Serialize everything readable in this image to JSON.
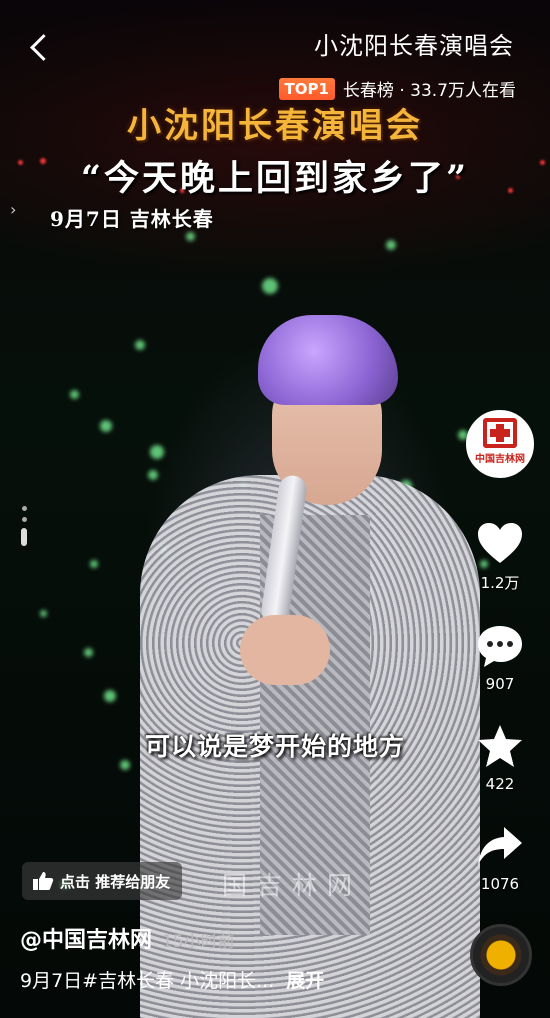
{
  "header": {
    "title": "小沈阳长春演唱会",
    "trend_badge": "TOP1",
    "trend_text": "长春榜 · 33.7万人在看"
  },
  "overlay": {
    "title": "小沈阳长春演唱会",
    "quote": "“今天晚上回到家乡了”",
    "date_location": "9月7日   吉林长春",
    "subtitle": "可以说是梦开始的地方",
    "watermark": "国吉林网"
  },
  "rail": {
    "avatar_label": "中国吉林网",
    "likes": "1.2万",
    "comments": "907",
    "favorites": "422",
    "shares": "1076"
  },
  "bottom": {
    "recommend_label": "点击 推荐给朋友",
    "author": "@中国吉林网",
    "time": "15小时前",
    "description": "9月7日#吉林长春 小沈阳长...",
    "expand": "展开"
  },
  "colors": {
    "title_gold": "#f5b53a",
    "top_badge": "#ff6a30",
    "logo_red": "#c8241d"
  },
  "icons": [
    "back-icon",
    "heart-icon",
    "comment-icon",
    "star-icon",
    "share-icon",
    "thumbs-up-icon",
    "music-disc-icon"
  ]
}
